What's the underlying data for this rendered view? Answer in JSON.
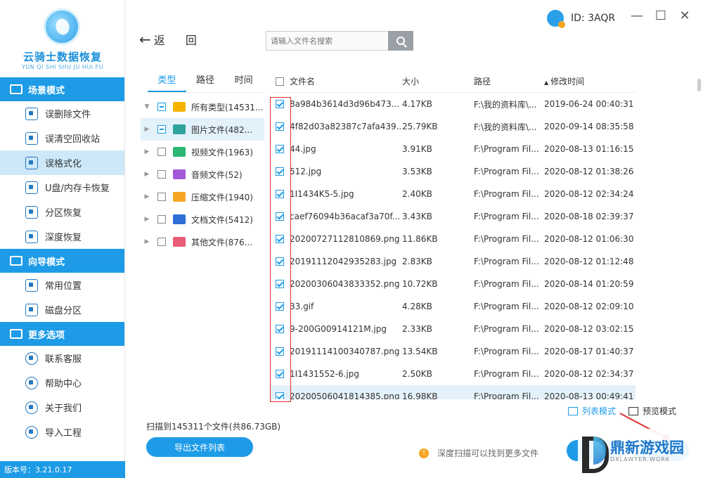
{
  "app": {
    "title": "云骑士数据恢复",
    "subtitle": "YUN QI SHI SHU JU HUI FU",
    "version": "版本号：3.21.0.17",
    "user_id": "ID: 3AQR"
  },
  "sidebar": {
    "sections": [
      {
        "label": "场景模式",
        "icon": "folder-icon",
        "items": [
          {
            "label": "误删除文件",
            "icon": "deleted-file-icon"
          },
          {
            "label": "误清空回收站",
            "icon": "recycle-bin-icon"
          },
          {
            "label": "误格式化",
            "icon": "format-icon",
            "active": true
          },
          {
            "label": "U盘/内存卡恢复",
            "icon": "usb-icon"
          },
          {
            "label": "分区恢复",
            "icon": "partition-icon"
          },
          {
            "label": "深度恢复",
            "icon": "deep-recovery-icon"
          }
        ]
      },
      {
        "label": "向导模式",
        "icon": "signpost-icon",
        "items": [
          {
            "label": "常用位置",
            "icon": "windows-icon"
          },
          {
            "label": "磁盘分区",
            "icon": "disk-icon"
          }
        ]
      },
      {
        "label": "更多选项",
        "icon": "menu-icon",
        "items": [
          {
            "label": "联系客服",
            "icon": "phone-icon"
          },
          {
            "label": "帮助中心",
            "icon": "help-icon"
          },
          {
            "label": "关于我们",
            "icon": "info-icon"
          },
          {
            "label": "导入工程",
            "icon": "import-icon"
          }
        ]
      }
    ]
  },
  "toolbar": {
    "back_label": "返 回",
    "search_placeholder": "请输入文件名搜索"
  },
  "type_tabs": [
    "类型",
    "路径",
    "时间"
  ],
  "tree": [
    {
      "label": "所有类型(14531...",
      "expand": "▼",
      "check": "partial",
      "icon_color": "#f5b400"
    },
    {
      "label": "图片文件(482...",
      "expand": "▶",
      "check": "partial",
      "icon_color": "#2ea39b",
      "selected": true
    },
    {
      "label": "视频文件(1963)",
      "expand": "▶",
      "check": "none",
      "icon_color": "#2bb673"
    },
    {
      "label": "音频文件(52)",
      "expand": "▶",
      "check": "none",
      "icon_color": "#a259d9"
    },
    {
      "label": "压缩文件(1940)",
      "expand": "▶",
      "check": "none",
      "icon_color": "#f5a623"
    },
    {
      "label": "文档文件(5412)",
      "expand": "▶",
      "check": "none",
      "icon_color": "#2d6fd6"
    },
    {
      "label": "其他文件(876...",
      "expand": "▶",
      "check": "none",
      "icon_color": "#e85d75"
    }
  ],
  "table": {
    "headers": {
      "name": "文件名",
      "size": "大小",
      "path": "路径",
      "mtime": "修改时间",
      "sort_icon": "▲"
    },
    "rows": [
      {
        "name": "8a984b3614d3d96b473...",
        "size": "4.17KB",
        "path": "F:\\我的资料库\\...",
        "mtime": "2019-06-24 00:40:31"
      },
      {
        "name": "4f82d03a82387c7afa439...",
        "size": "25.79KB",
        "path": "F:\\我的资料库\\...",
        "mtime": "2020-09-14 08:35:58"
      },
      {
        "name": "44.jpg",
        "size": "3.91KB",
        "path": "F:\\Program Fil...",
        "mtime": "2020-08-13 01:16:15"
      },
      {
        "name": "512.jpg",
        "size": "3.53KB",
        "path": "F:\\Program Fil...",
        "mtime": "2020-08-12 01:38:26"
      },
      {
        "name": "1I1434K5-5.jpg",
        "size": "2.40KB",
        "path": "F:\\Program Fil...",
        "mtime": "2020-08-12 02:34:24"
      },
      {
        "name": "caef76094b36acaf3a70f...",
        "size": "3.43KB",
        "path": "F:\\Program Fil...",
        "mtime": "2020-08-18 02:39:37"
      },
      {
        "name": "20200727112810869.png",
        "size": "11.86KB",
        "path": "F:\\Program Fil...",
        "mtime": "2020-08-12 01:06:30"
      },
      {
        "name": "20191112042935283.jpg",
        "size": "2.83KB",
        "path": "F:\\Program Fil...",
        "mtime": "2020-08-12 01:12:48"
      },
      {
        "name": "20200306043833352.png",
        "size": "10.72KB",
        "path": "F:\\Program Fil...",
        "mtime": "2020-08-14 01:20:59"
      },
      {
        "name": "33.gif",
        "size": "4.28KB",
        "path": "F:\\Program Fil...",
        "mtime": "2020-08-12 02:09:10"
      },
      {
        "name": "9-200G00914121M.jpg",
        "size": "2.33KB",
        "path": "F:\\Program Fil...",
        "mtime": "2020-08-12 03:02:15"
      },
      {
        "name": "20191114100340787.png",
        "size": "13.54KB",
        "path": "F:\\Program Fil...",
        "mtime": "2020-08-17 01:40:37"
      },
      {
        "name": "1I1431552-6.jpg",
        "size": "2.50KB",
        "path": "F:\\Program Fil...",
        "mtime": "2020-08-12 02:34:37"
      },
      {
        "name": "20200506041814385.png",
        "size": "16.98KB",
        "path": "F:\\Program Fil...",
        "mtime": "2020-08-13 00:49:41",
        "highlight": true
      }
    ]
  },
  "view_modes": {
    "list": "列表模式",
    "preview": "预览模式"
  },
  "footer": {
    "scan_info": "扫描到145311个文件(共86.73GB)",
    "export_label": "导出文件列表",
    "tip": "深度扫描可以找到更多文件"
  },
  "watermark": {
    "title": "鼎新游戏园",
    "sub": "DXLAWYER.WORK"
  },
  "colors": {
    "accent": "#1d9be6",
    "highlight_box": "#d9302c"
  }
}
